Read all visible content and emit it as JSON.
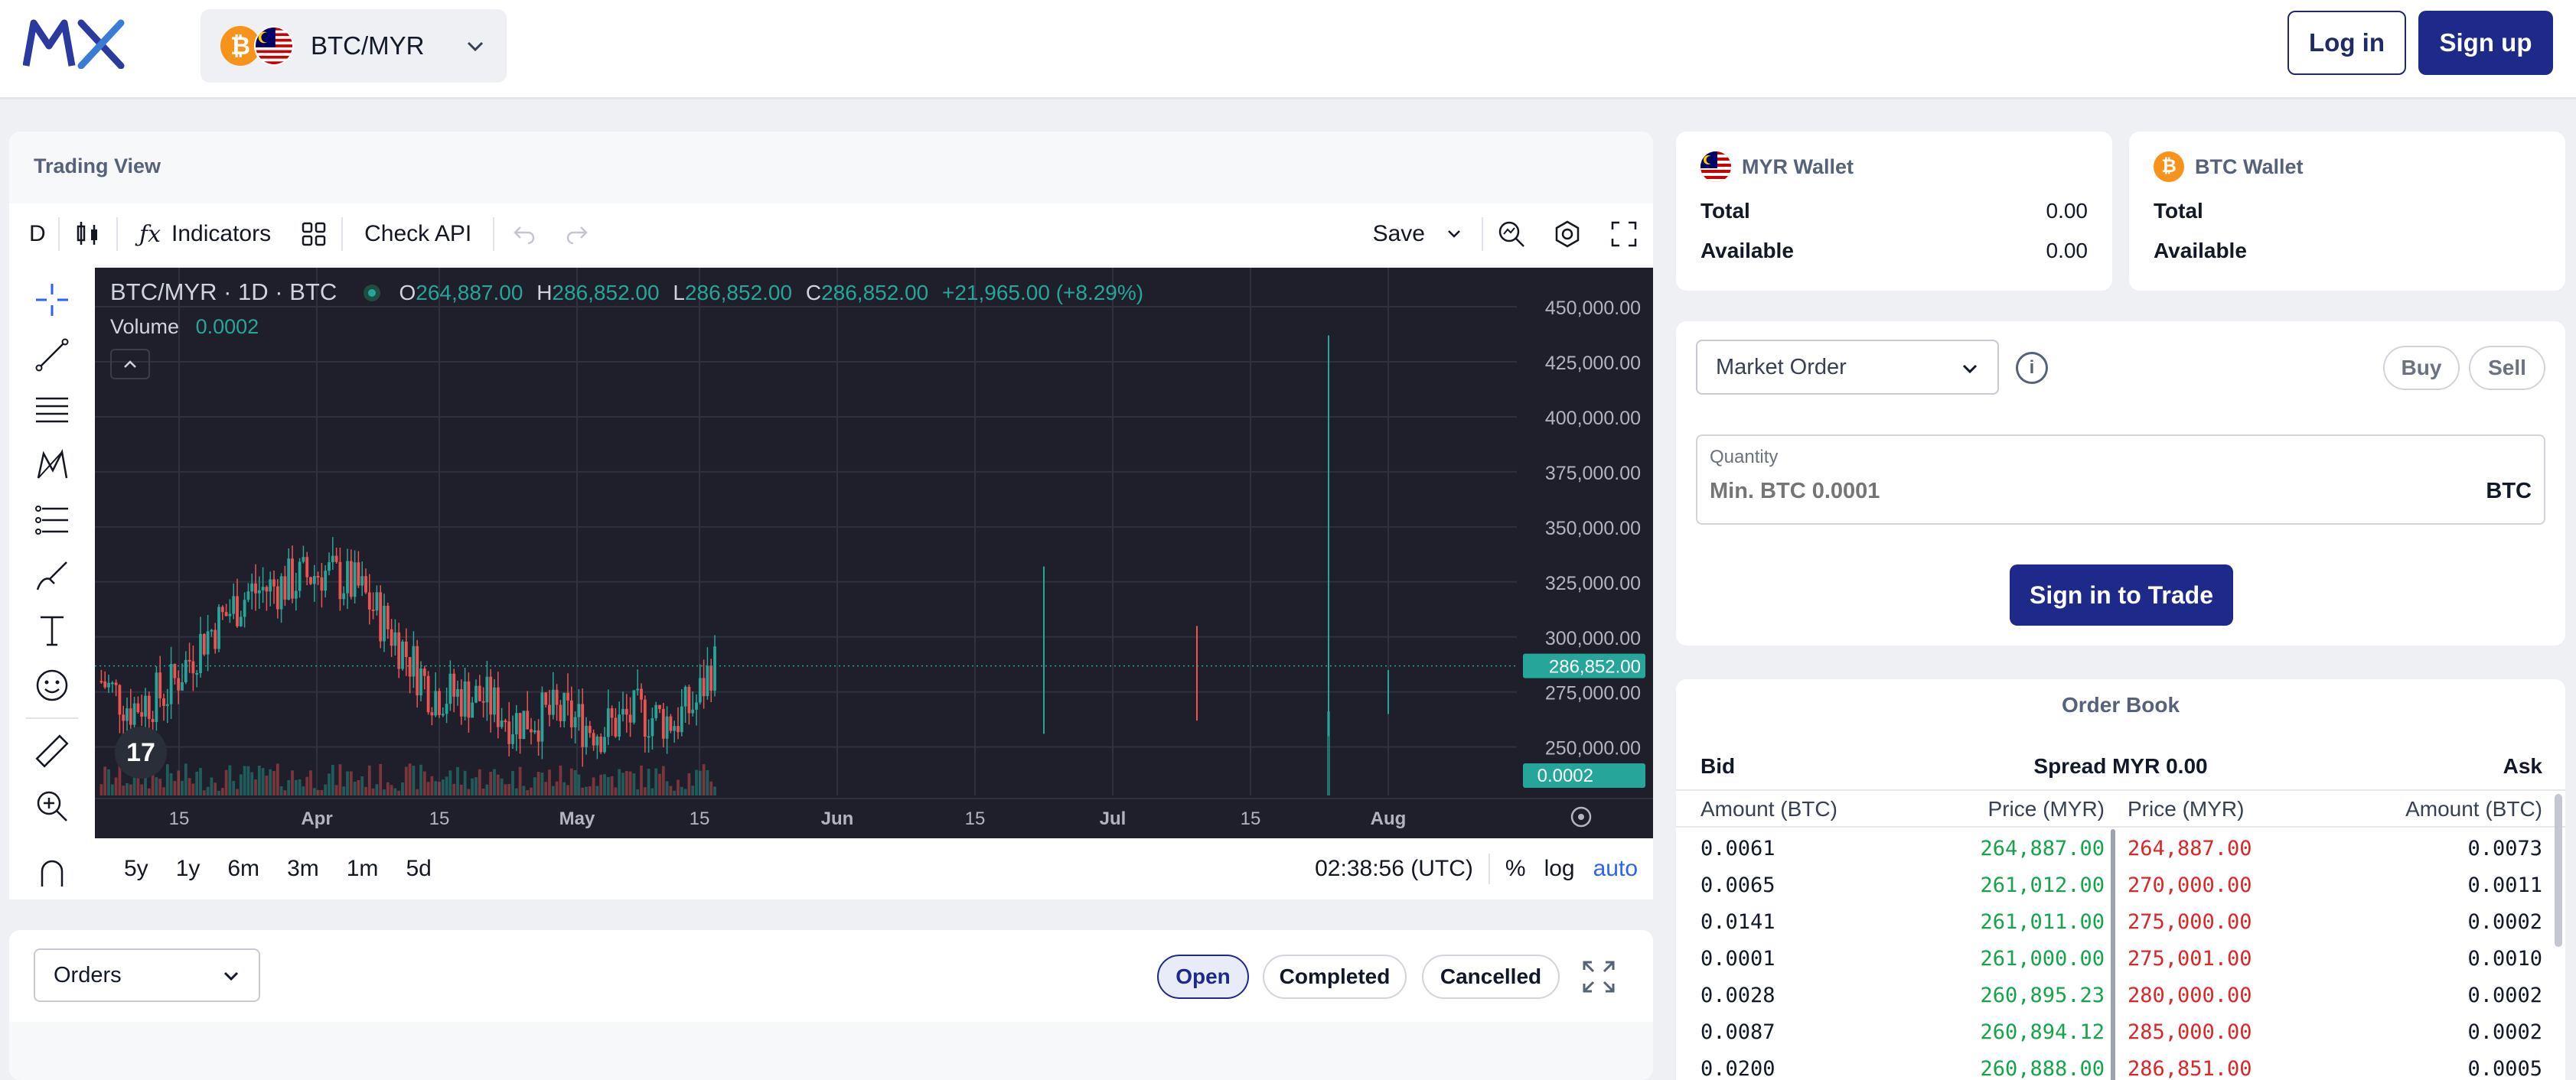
{
  "header": {
    "logo_alt": "MX",
    "pair": "BTC/MYR",
    "login_label": "Log in",
    "signup_label": "Sign up"
  },
  "trading_view": {
    "title": "Trading View",
    "toolbar": {
      "interval": "D",
      "indicators_label": "Indicators",
      "check_api_label": "Check API",
      "save_label": "Save"
    },
    "legend": {
      "symbol": "BTC/MYR · 1D · BTC",
      "open_label": "O",
      "open": "264,887.00",
      "high_label": "H",
      "high": "286,852.00",
      "low_label": "L",
      "low": "286,852.00",
      "close_label": "C",
      "close": "286,852.00",
      "change": "+21,965.00 (+8.29%)",
      "volume_label": "Volume",
      "volume": "0.0002"
    },
    "bottom_bar": {
      "ranges": [
        "5y",
        "1y",
        "6m",
        "3m",
        "1m",
        "5d"
      ],
      "time": "02:38:56 (UTC)",
      "percent_label": "%",
      "log_label": "log",
      "auto_label": "auto"
    }
  },
  "chart_data": {
    "type": "candlestick",
    "title": "BTC/MYR · 1D · BTC",
    "x_tick_labels": [
      "15",
      "Apr",
      "15",
      "May",
      "15",
      "Jun",
      "15",
      "Jul",
      "15",
      "Aug"
    ],
    "y_tick_labels": [
      "450,000.00",
      "425,000.00",
      "400,000.00",
      "375,000.00",
      "350,000.00",
      "325,000.00",
      "300,000.00",
      "275,000.00",
      "250,000.00"
    ],
    "ylim": [
      228000,
      458000
    ],
    "last_price_label": "286,852.00",
    "last_volume_label": "0.0002",
    "colors": {
      "up": "#26a69a",
      "down": "#ef5350",
      "background": "#1e1f2a"
    },
    "grid": true
  },
  "wallets": [
    {
      "name": "MYR Wallet",
      "total_label": "Total",
      "total": "0.00",
      "available_label": "Available",
      "available": "0.00"
    },
    {
      "name": "BTC Wallet",
      "total_label": "Total",
      "total": "",
      "available_label": "Available",
      "available": ""
    }
  ],
  "order_form": {
    "order_type": "Market Order",
    "buy_label": "Buy",
    "sell_label": "Sell",
    "quantity_label": "Quantity",
    "quantity_placeholder": "Min. BTC 0.0001",
    "quantity_unit": "BTC",
    "submit_label": "Sign in to Trade"
  },
  "order_book": {
    "title": "Order Book",
    "bid_label": "Bid",
    "spread_label": "Spread MYR 0.00",
    "ask_label": "Ask",
    "columns": [
      "Amount (BTC)",
      "Price (MYR)",
      "Price (MYR)",
      "Amount (BTC)"
    ],
    "rows": [
      {
        "bid_amount": "0.0061",
        "bid_price": "264,887.00",
        "ask_price": "264,887.00",
        "ask_amount": "0.0073"
      },
      {
        "bid_amount": "0.0065",
        "bid_price": "261,012.00",
        "ask_price": "270,000.00",
        "ask_amount": "0.0011"
      },
      {
        "bid_amount": "0.0141",
        "bid_price": "261,011.00",
        "ask_price": "275,000.00",
        "ask_amount": "0.0002"
      },
      {
        "bid_amount": "0.0001",
        "bid_price": "261,000.00",
        "ask_price": "275,001.00",
        "ask_amount": "0.0010"
      },
      {
        "bid_amount": "0.0028",
        "bid_price": "260,895.23",
        "ask_price": "280,000.00",
        "ask_amount": "0.0002"
      },
      {
        "bid_amount": "0.0087",
        "bid_price": "260,894.12",
        "ask_price": "285,000.00",
        "ask_amount": "0.0002"
      },
      {
        "bid_amount": "0.0200",
        "bid_price": "260,888.00",
        "ask_price": "286,851.00",
        "ask_amount": "0.0005"
      }
    ]
  },
  "orders": {
    "select_label": "Orders",
    "tabs": [
      "Open",
      "Completed",
      "Cancelled"
    ],
    "active_tab": "Open"
  },
  "colors": {
    "brand": "#1d2a8a",
    "bid": "#16a34a",
    "ask": "#dc2626"
  }
}
